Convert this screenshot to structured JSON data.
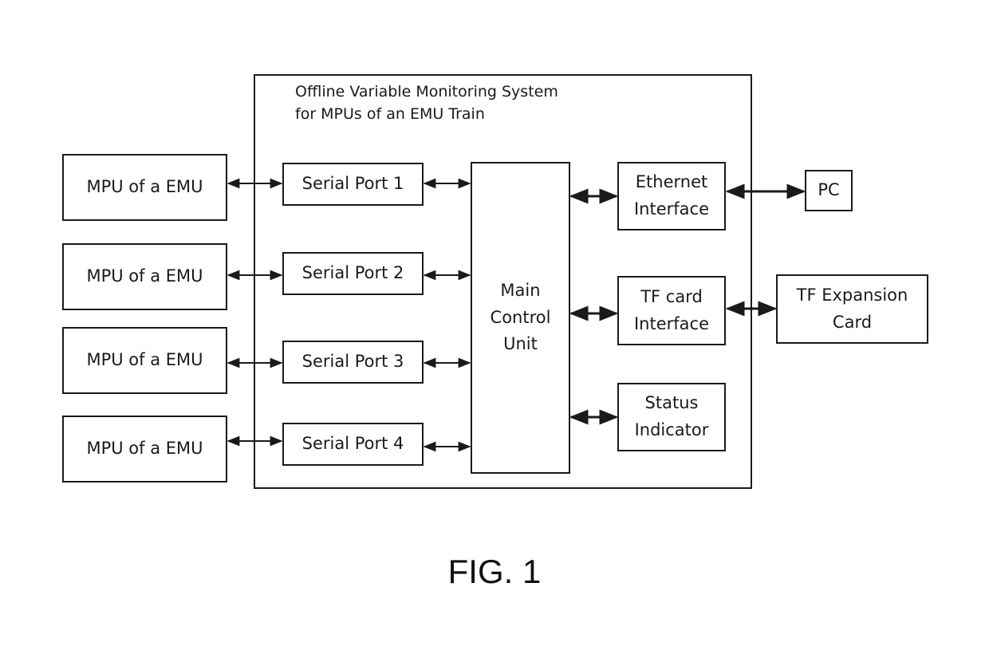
{
  "diagram": {
    "system": {
      "title": "Offline Variable Monitoring System\nfor MPUs of an EMU Train"
    },
    "external_left": [
      {
        "label": "MPU of a EMU"
      },
      {
        "label": "MPU of a EMU"
      },
      {
        "label": "MPU of a EMU"
      },
      {
        "label": "MPU of a EMU"
      }
    ],
    "serial_ports": [
      {
        "label": "Serial Port 1"
      },
      {
        "label": "Serial Port 2"
      },
      {
        "label": "Serial Port 3"
      },
      {
        "label": "Serial Port 4"
      }
    ],
    "main_control_unit": {
      "label": "Main\nControl\nUnit"
    },
    "interfaces": [
      {
        "label": "Ethernet\nInterface"
      },
      {
        "label": "TF card\nInterface"
      },
      {
        "label": "Status\nIndicator"
      }
    ],
    "external_right": [
      {
        "label": "PC"
      },
      {
        "label": "TF Expansion\nCard"
      }
    ],
    "connections": [
      {
        "from": "MPU of a EMU (1)",
        "to": "Serial Port 1",
        "type": "bidirectional"
      },
      {
        "from": "MPU of a EMU (2)",
        "to": "Serial Port 2",
        "type": "bidirectional"
      },
      {
        "from": "MPU of a EMU (3)",
        "to": "Serial Port 3",
        "type": "bidirectional"
      },
      {
        "from": "MPU of a EMU (4)",
        "to": "Serial Port 4",
        "type": "bidirectional"
      },
      {
        "from": "Serial Port 1",
        "to": "Main Control Unit",
        "type": "bidirectional"
      },
      {
        "from": "Serial Port 2",
        "to": "Main Control Unit",
        "type": "bidirectional"
      },
      {
        "from": "Serial Port 3",
        "to": "Main Control Unit",
        "type": "bidirectional"
      },
      {
        "from": "Serial Port 4",
        "to": "Main Control Unit",
        "type": "bidirectional"
      },
      {
        "from": "Main Control Unit",
        "to": "Ethernet Interface",
        "type": "bidirectional"
      },
      {
        "from": "Main Control Unit",
        "to": "TF card Interface",
        "type": "bidirectional"
      },
      {
        "from": "Main Control Unit",
        "to": "Status Indicator",
        "type": "bidirectional"
      },
      {
        "from": "Ethernet Interface",
        "to": "PC",
        "type": "bidirectional"
      },
      {
        "from": "TF card Interface",
        "to": "TF Expansion Card",
        "type": "bidirectional"
      }
    ],
    "caption": "FIG. 1"
  }
}
